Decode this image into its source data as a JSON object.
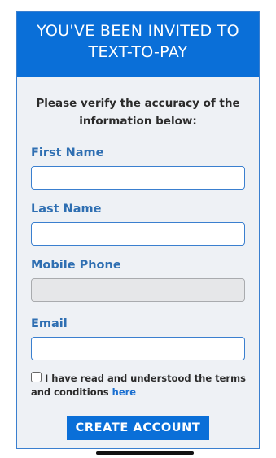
{
  "header": {
    "line1": "YOU'VE BEEN INVITED TO",
    "line2": "TEXT-TO-PAY"
  },
  "intro": "Please verify the accuracy of the information below:",
  "fields": {
    "first_name": {
      "label": "First Name",
      "value": ""
    },
    "last_name": {
      "label": "Last Name",
      "value": ""
    },
    "mobile_phone": {
      "label": "Mobile Phone",
      "value": ""
    },
    "email": {
      "label": "Email",
      "value": ""
    }
  },
  "terms": {
    "text": "I have read and understood the terms and conditions ",
    "link": "here",
    "checked": false
  },
  "button": {
    "label": "CREATE ACCOUNT"
  },
  "colors": {
    "primary": "#0a6fd8",
    "label": "#2f6fb2",
    "background": "#eef1f5"
  }
}
